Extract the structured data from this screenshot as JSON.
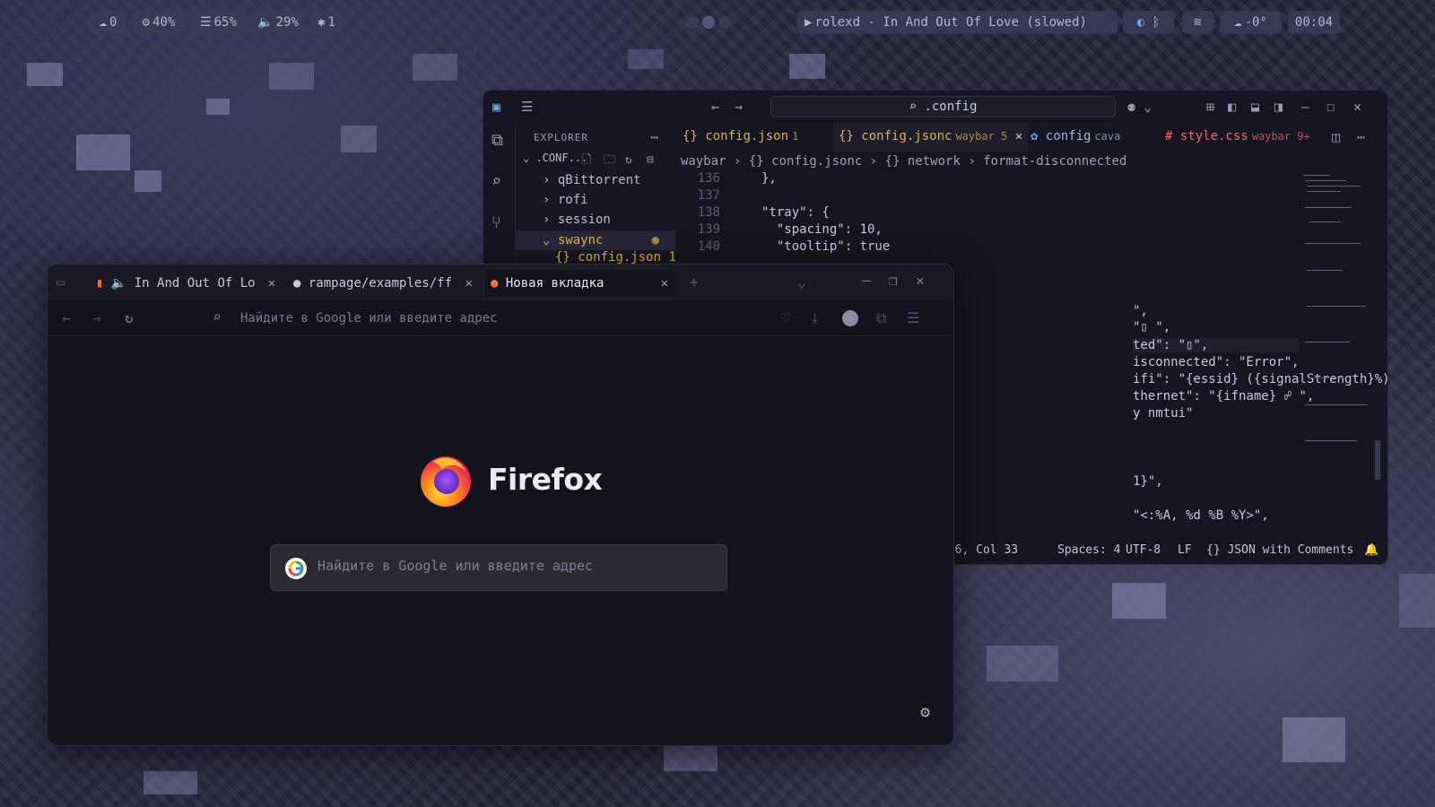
{
  "topbar": {
    "left": [
      {
        "icon": "cloud-icon",
        "glyph": "☁",
        "text": "0"
      },
      {
        "icon": "cpu-icon",
        "glyph": "⚙",
        "text": "40%"
      },
      {
        "icon": "memory-icon",
        "glyph": "☰",
        "text": "65%"
      },
      {
        "icon": "volume-icon",
        "glyph": "🔈",
        "text": "29%"
      },
      {
        "icon": "bluetooth-icon",
        "glyph": "✱",
        "text": "1"
      }
    ],
    "media": {
      "glyph": "▶",
      "text": "rolexd - In And Out Of Love (slowed)"
    },
    "weather": {
      "glyph": "☁",
      "text": "-0°"
    },
    "clock": "00:04"
  },
  "vscode": {
    "search": ".config",
    "explorer": {
      "title": "EXPLORER",
      "root": ".CONF...",
      "items": [
        "qBittorrent",
        "rofi",
        "session",
        "swaync",
        "config.json 1"
      ]
    },
    "tabs": [
      {
        "label": "config.json",
        "badge": "1",
        "color": "#e3b341"
      },
      {
        "label": "config.jsonc",
        "badge": "waybar 5",
        "color": "#e3b341"
      },
      {
        "label": "config",
        "badge": "cava",
        "color": "#a7b6e0"
      },
      {
        "label": "style.css",
        "badge": "waybar 9+",
        "color": "#ef6a6a"
      }
    ],
    "breadcrumb": [
      "waybar",
      "{} config.jsonc",
      "{} network",
      "format-disconnected"
    ],
    "lines": [
      {
        "n": "136",
        "t": "},"
      },
      {
        "n": "137",
        "t": ""
      },
      {
        "n": "138",
        "t": "\"tray\": {"
      },
      {
        "n": "139",
        "t": "  \"spacing\": 10,"
      },
      {
        "n": "140",
        "t": "  \"tooltip\": true"
      }
    ],
    "partial_lines": [
      "\",",
      "\"▯ \",",
      "ted\": \"▯\",",
      "isconnected\": \"Error\",",
      "ifi\": \"{essid} ({signalStrength}%)▯\",",
      "thernet\": \"{ifname} ☍ \",",
      "y nmtui\"",
      "1}\",",
      "\"<:%A, %d %B %Y>\","
    ],
    "status": {
      "position": "146, Col 33",
      "spaces": "Spaces: 4",
      "encoding": "UTF-8",
      "eol": "LF",
      "language": "{} JSON with Comments"
    }
  },
  "firefox": {
    "tabs": [
      {
        "label": "In And Out Of Lo",
        "icon": "soundcloud-icon"
      },
      {
        "label": "rampage/examples/ff",
        "icon": "github-icon"
      },
      {
        "label": "Новая вкладка",
        "icon": "firefox-icon"
      }
    ],
    "url_placeholder": "Найдите в Google или введите адрес",
    "brand": "Firefox",
    "search_placeholder": "Найдите в Google или введите адрес"
  },
  "colors": {
    "accent_yellow": "#e3b341",
    "accent_red": "#ef6a6a",
    "firefox_orange": "#ff7139",
    "firefox_purple": "#8e44ad"
  }
}
